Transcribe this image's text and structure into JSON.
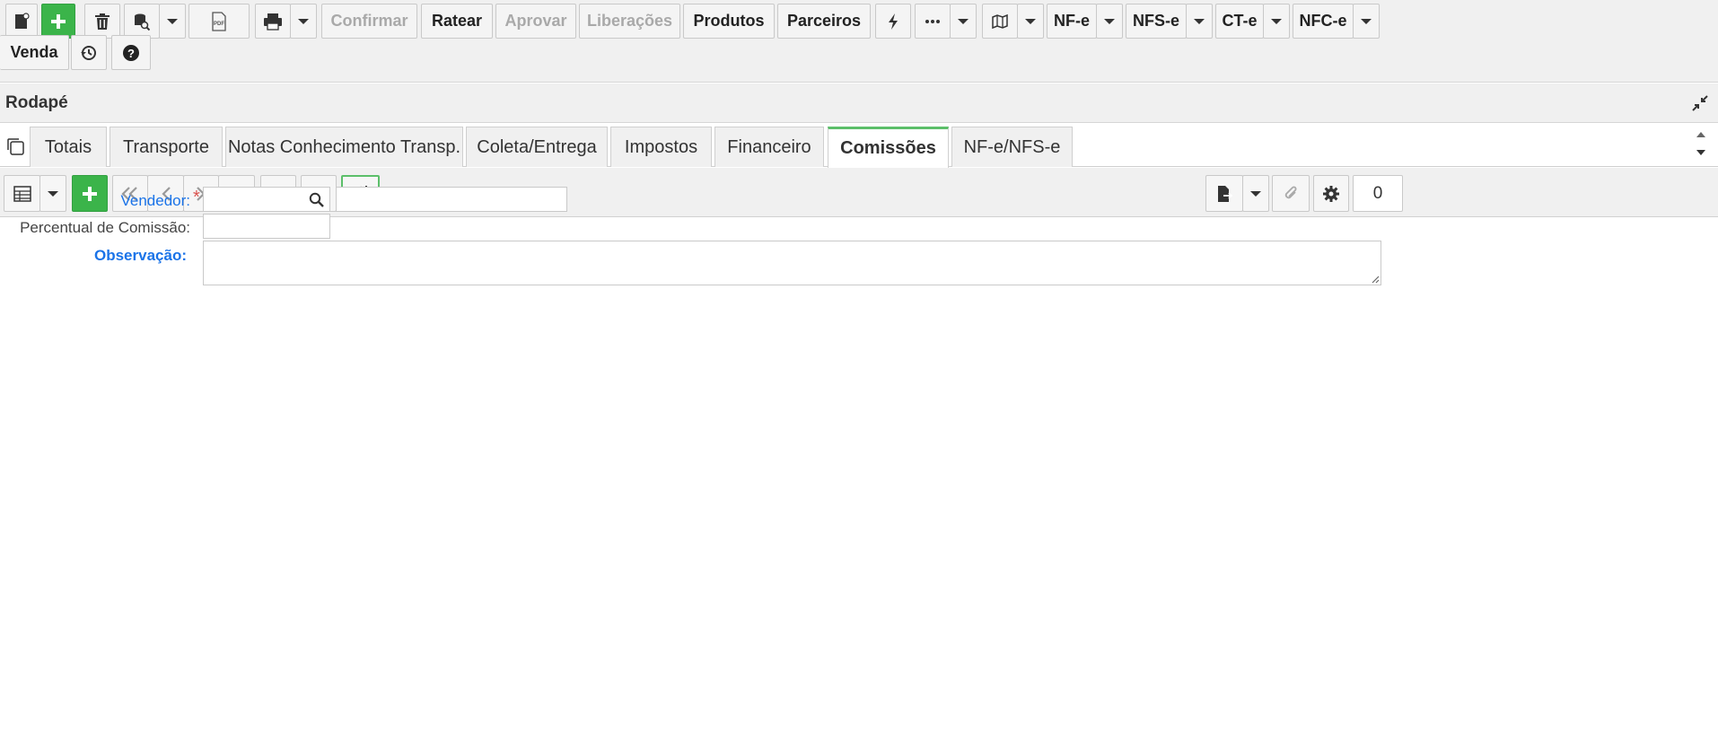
{
  "toolbar": {
    "confirmar": "Confirmar",
    "ratear": "Ratear",
    "aprovar": "Aprovar",
    "liberacoes": "Liberações",
    "produtos": "Produtos",
    "parceiros": "Parceiros",
    "nfe": "NF-e",
    "nfse": "NFS-e",
    "cte": "CT-e",
    "nfce": "NFC-e",
    "venda": "Venda",
    "pdf_icon_text": "PDF"
  },
  "section": {
    "title": "Rodapé"
  },
  "tabs": [
    {
      "label": "Totais"
    },
    {
      "label": "Transporte"
    },
    {
      "label": "Notas Conhecimento Transp."
    },
    {
      "label": "Coleta/Entrega"
    },
    {
      "label": "Impostos"
    },
    {
      "label": "Financeiro"
    },
    {
      "label": "Comissões",
      "active": true
    },
    {
      "label": "NF-e/NFS-e"
    }
  ],
  "gridbar": {
    "record_count": "0"
  },
  "form": {
    "vendedor_label": "Vendedor:",
    "required_mark": "*",
    "vendedor_code": "",
    "vendedor_name": "",
    "percentual_label": "Percentual de Comissão:",
    "percentual_value": "",
    "observacao_label": "Observação:",
    "observacao_value": ""
  },
  "colors": {
    "accent_green": "#3bb44a",
    "link_blue": "#1a73e8",
    "required_red": "#d9534f",
    "tab_active_border": "#5cbf6a"
  }
}
